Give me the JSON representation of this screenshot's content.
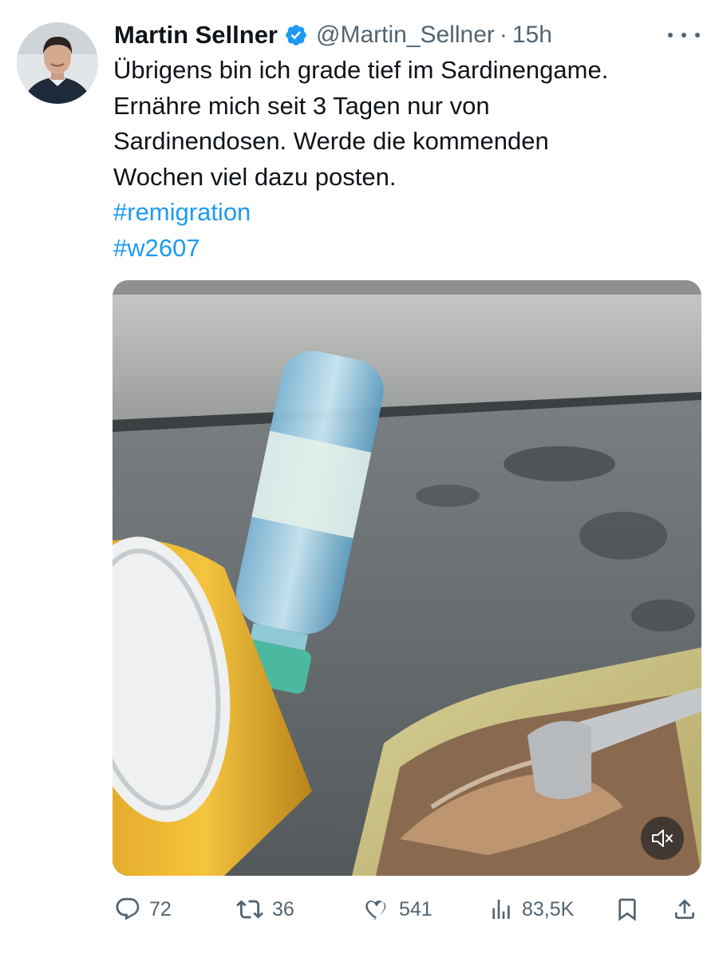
{
  "author": {
    "name": "Martin Sellner",
    "handle": "@Martin_Sellner",
    "separator": "·",
    "time": "15h"
  },
  "post": {
    "lines": [
      "Übrigens bin ich grade tief im Sardinengame.",
      "Ernähre mich seit 3 Tagen nur von",
      "Sardinendosen. Werde die kommenden",
      "Wochen viel dazu posten."
    ],
    "hashtags": [
      "#remigration",
      "#w2607"
    ]
  },
  "media": {
    "type": "video",
    "muted": true
  },
  "actions": {
    "replies": "72",
    "reposts": "36",
    "likes": "541",
    "views": "83,5K"
  },
  "colors": {
    "accent": "#1d9bf0",
    "secondary_text": "#536471",
    "primary_text": "#0f1419"
  },
  "icons": [
    "verified-badge-icon",
    "more-icon",
    "mute-icon",
    "reply-icon",
    "repost-icon",
    "like-icon",
    "views-icon",
    "bookmark-icon",
    "share-icon"
  ]
}
